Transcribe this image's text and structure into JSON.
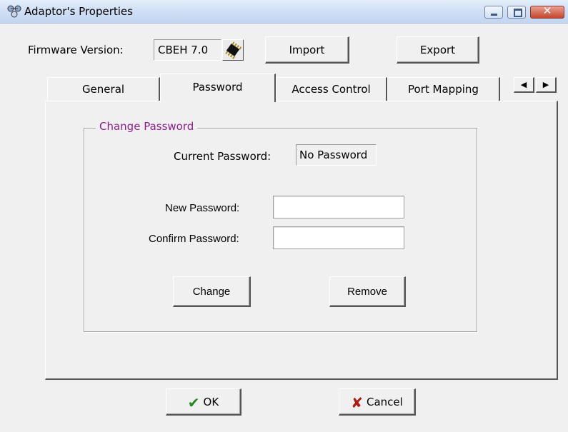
{
  "window": {
    "title": "Adaptor's Properties",
    "controls": {
      "minimize": "–",
      "maximize": "□",
      "close": "✕"
    }
  },
  "firmware": {
    "label": "Firmware Version:",
    "value": "CBEH 7.0",
    "chip_icon": "chip-icon"
  },
  "toolbar": {
    "import_label": "Import",
    "export_label": "Export"
  },
  "tabs": [
    {
      "label": "General",
      "active": false
    },
    {
      "label": "Password",
      "active": true
    },
    {
      "label": "Access Control",
      "active": false
    },
    {
      "label": "Port Mapping",
      "active": false
    }
  ],
  "tab_scroll": {
    "left": "◀",
    "right": "▶"
  },
  "password_group": {
    "title": "Change Password",
    "current_label": "Current Password:",
    "current_value": "No Password",
    "new_label": "New Password:",
    "new_value": "",
    "confirm_label": "Confirm Password:",
    "confirm_value": "",
    "change_label": "Change",
    "remove_label": "Remove"
  },
  "footer": {
    "ok_label": "OK",
    "cancel_label": "Cancel",
    "ok_glyph": "✔",
    "cancel_glyph": "✘"
  },
  "colors": {
    "group_title": "#8e1e8e",
    "ok_check": "#1e8a1e",
    "cancel_cross": "#b11a10"
  }
}
